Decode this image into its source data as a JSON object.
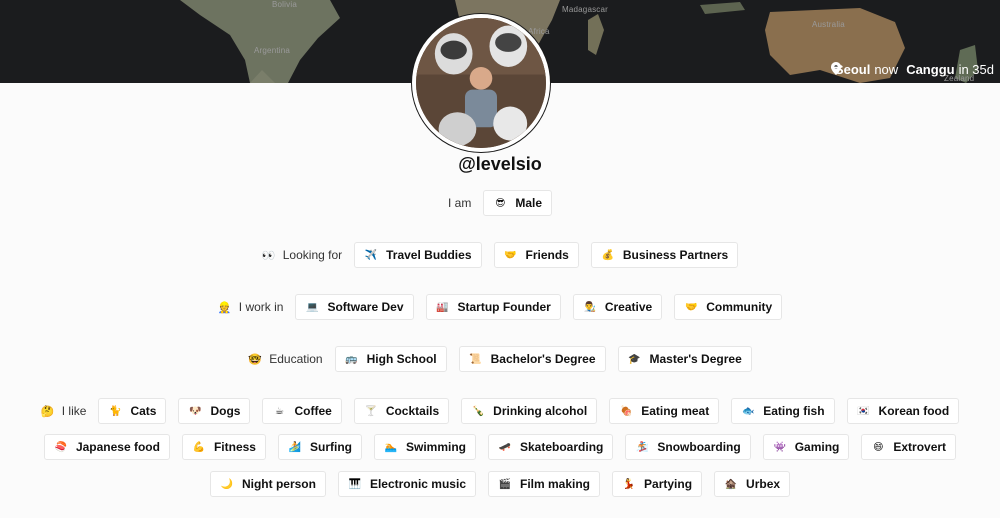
{
  "map": {
    "labels": [
      "Bolivia",
      "Argentina",
      "Africa",
      "Madagascar",
      "Australia",
      "Zealand"
    ]
  },
  "travel": {
    "pin_icon": "location-pin-icon",
    "from": "Seoul",
    "now": "now",
    "arrow_icon": "arrow-right-icon",
    "to": "Canggu",
    "in_text": "in 35d"
  },
  "profile": {
    "username": "@levelsio",
    "avatar": "avatar-photo"
  },
  "sections": {
    "iam": {
      "label": "I am",
      "chips": [
        {
          "emoji": "😎",
          "label": "Male"
        }
      ]
    },
    "looking_for": {
      "emoji": "👀",
      "label": "Looking for",
      "chips": [
        {
          "emoji": "✈️",
          "label": "Travel Buddies"
        },
        {
          "emoji": "🤝",
          "label": "Friends"
        },
        {
          "emoji": "💰",
          "label": "Business Partners"
        }
      ]
    },
    "work": {
      "emoji": "👷",
      "label": "I work in",
      "chips": [
        {
          "emoji": "💻",
          "label": "Software Dev"
        },
        {
          "emoji": "🏭",
          "label": "Startup Founder"
        },
        {
          "emoji": "👨‍🎨",
          "label": "Creative"
        },
        {
          "emoji": "🤝",
          "label": "Community"
        }
      ]
    },
    "education": {
      "emoji": "🤓",
      "label": "Education",
      "chips": [
        {
          "emoji": "🚌",
          "label": "High School"
        },
        {
          "emoji": "📜",
          "label": "Bachelor's Degree"
        },
        {
          "emoji": "🎓",
          "label": "Master's Degree"
        }
      ]
    },
    "likes": {
      "emoji": "🤔",
      "label": "I like",
      "row1": [
        {
          "emoji": "🐈",
          "label": "Cats"
        },
        {
          "emoji": "🐶",
          "label": "Dogs"
        },
        {
          "emoji": "☕",
          "label": "Coffee"
        },
        {
          "emoji": "🍸",
          "label": "Cocktails"
        },
        {
          "emoji": "🍾",
          "label": "Drinking alcohol"
        },
        {
          "emoji": "🍖",
          "label": "Eating meat"
        },
        {
          "emoji": "🐟",
          "label": "Eating fish"
        },
        {
          "emoji": "🇰🇷",
          "label": "Korean food"
        }
      ],
      "row2": [
        {
          "emoji": "🍣",
          "label": "Japanese food"
        },
        {
          "emoji": "💪",
          "label": "Fitness"
        },
        {
          "emoji": "🏄",
          "label": "Surfing"
        },
        {
          "emoji": "🏊",
          "label": "Swimming"
        },
        {
          "emoji": "🛹",
          "label": "Skateboarding"
        },
        {
          "emoji": "🏂",
          "label": "Snowboarding"
        },
        {
          "emoji": "👾",
          "label": "Gaming"
        },
        {
          "emoji": "😄",
          "label": "Extrovert"
        }
      ],
      "row3": [
        {
          "emoji": "🌙",
          "label": "Night person"
        },
        {
          "emoji": "🎹",
          "label": "Electronic music"
        },
        {
          "emoji": "🎬",
          "label": "Film making"
        },
        {
          "emoji": "💃",
          "label": "Partying"
        },
        {
          "emoji": "🏚️",
          "label": "Urbex"
        }
      ]
    }
  }
}
